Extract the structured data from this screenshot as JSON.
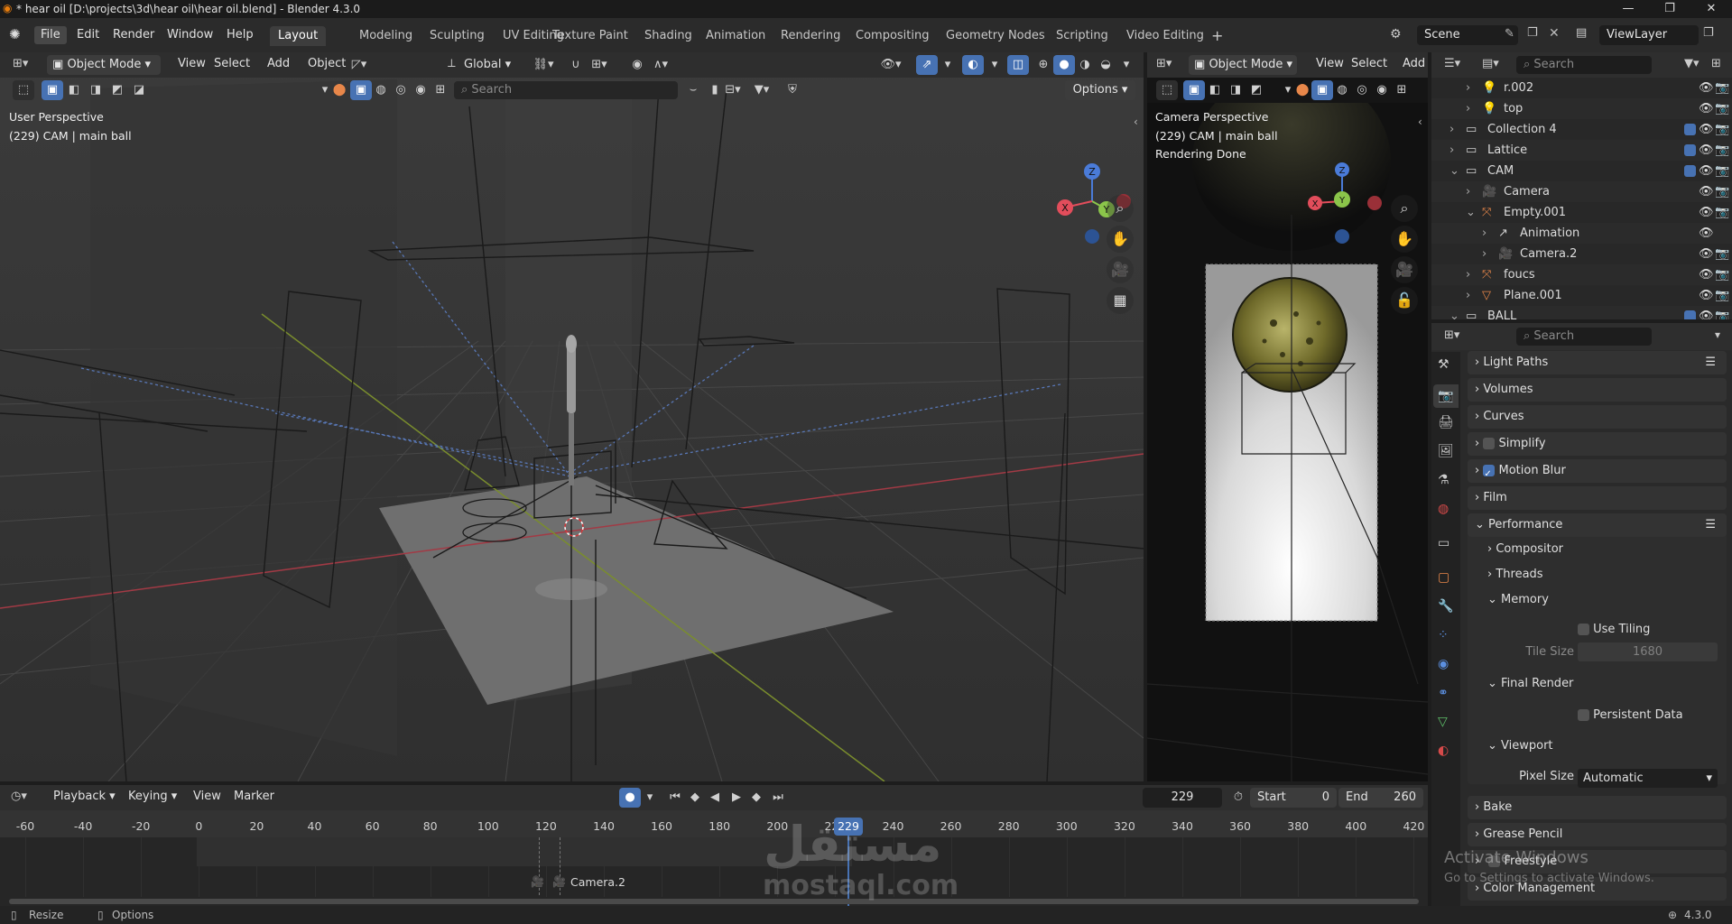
{
  "window": {
    "title": "* hear oil [D:\\projects\\3d\\hear oil\\hear oil.blend] - Blender 4.3.0",
    "minimize": "—",
    "maximize": "❐",
    "close": "✕"
  },
  "menus": [
    "File",
    "Edit",
    "Render",
    "Window",
    "Help"
  ],
  "workspaces": [
    "Layout",
    "Modeling",
    "Sculpting",
    "UV Editing",
    "Texture Paint",
    "Shading",
    "Animation",
    "Rendering",
    "Compositing",
    "Geometry Nodes",
    "Scripting",
    "Video Editing"
  ],
  "add_workspace": "+",
  "scene": {
    "name": "Scene",
    "view_layer": "ViewLayer"
  },
  "viewport": {
    "mode": "Object Mode",
    "menus": [
      "View",
      "Select",
      "Add",
      "Object"
    ],
    "orientation": "Global",
    "search_placeholder": "Search",
    "options": "Options",
    "overlay_line1": "User Perspective",
    "overlay_line2": "(229) CAM | main ball",
    "gizmo": {
      "z": "Z",
      "y": "Y",
      "x": "X"
    }
  },
  "camera_view": {
    "mode": "Object Mode",
    "menus": [
      "View",
      "Select",
      "Add"
    ],
    "overlay_line1": "Camera Perspective",
    "overlay_line2": "(229) CAM | main ball",
    "overlay_line3": "Rendering Done",
    "gizmo": {
      "z": "Z",
      "y": "Y",
      "x": "X"
    }
  },
  "outliner": {
    "search_placeholder": "Search",
    "rows": [
      {
        "label": "r.002",
        "indent": 2
      },
      {
        "label": "top",
        "indent": 2
      },
      {
        "label": "Collection 4",
        "indent": 1
      },
      {
        "label": "Lattice",
        "indent": 1
      },
      {
        "label": "CAM",
        "indent": 1
      },
      {
        "label": "Camera",
        "indent": 2
      },
      {
        "label": "Empty.001",
        "indent": 2
      },
      {
        "label": "Animation",
        "indent": 3
      },
      {
        "label": "Camera.2",
        "indent": 3
      },
      {
        "label": "foucs",
        "indent": 2
      },
      {
        "label": "Plane.001",
        "indent": 2
      },
      {
        "label": "BALL",
        "indent": 1
      }
    ]
  },
  "properties": {
    "search_placeholder": "Search",
    "panels": {
      "light_paths": "Light Paths",
      "volumes": "Volumes",
      "curves": "Curves",
      "simplify": "Simplify",
      "motion_blur": "Motion Blur",
      "film": "Film",
      "performance": "Performance",
      "compositor": "Compositor",
      "threads": "Threads",
      "memory": "Memory",
      "use_tiling": "Use Tiling",
      "tile_size_label": "Tile Size",
      "tile_size_value": "1680",
      "final_render": "Final Render",
      "persistent_data": "Persistent Data",
      "viewport": "Viewport",
      "pixel_size_label": "Pixel Size",
      "pixel_size_value": "Automatic",
      "bake": "Bake",
      "grease_pencil": "Grease Pencil",
      "freestyle": "Freestyle",
      "color_management": "Color Management"
    },
    "motion_blur_enabled": true,
    "simplify_enabled": false,
    "use_tiling_enabled": false,
    "persistent_data_enabled": false
  },
  "timeline": {
    "menus": [
      "Playback",
      "Keying",
      "View",
      "Marker"
    ],
    "current_frame": "229",
    "start_label": "Start",
    "start_value": "0",
    "end_label": "End",
    "end_value": "260",
    "ticks": [
      "-60",
      "-40",
      "-20",
      "0",
      "20",
      "40",
      "60",
      "80",
      "100",
      "120",
      "140",
      "160",
      "180",
      "200",
      "220",
      "240",
      "260",
      "280",
      "300",
      "320",
      "340",
      "360",
      "380",
      "400",
      "420"
    ],
    "playhead": "229",
    "marker_label": "Camera.2"
  },
  "watermark": {
    "arabic": "مستقل",
    "latin": "mostaql.com"
  },
  "activate_windows": {
    "line1": "Activate Windows",
    "line2": "Go to Settings to activate Windows."
  },
  "status": {
    "resize": "Resize",
    "options": "Options",
    "version": "4.3.0"
  },
  "colors": {
    "accent": "#4772b3",
    "x_axis": "#e24d5b",
    "y_axis": "#8bc54a",
    "z_axis": "#4a7bd8",
    "keyframe_playhead": "#4772b3"
  }
}
